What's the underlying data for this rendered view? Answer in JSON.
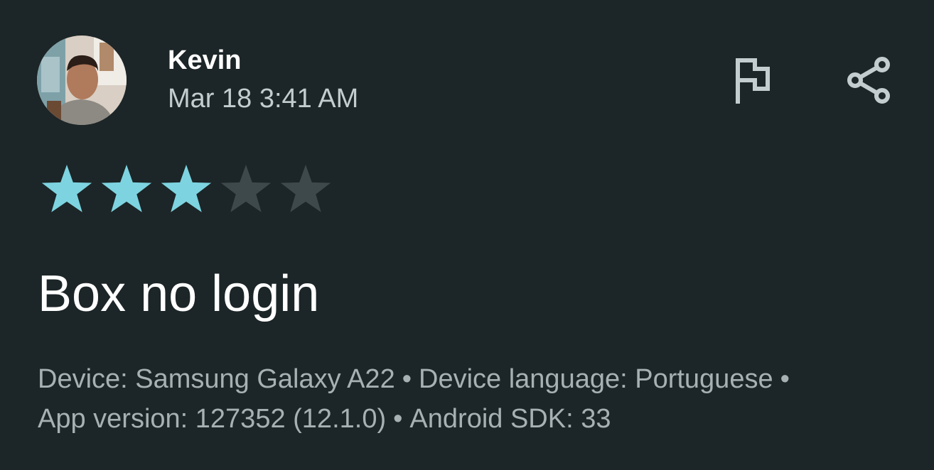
{
  "review": {
    "author": "Kevin",
    "date": "Mar 18 3:41 AM",
    "rating": 3,
    "max_rating": 5,
    "title": "Box no login",
    "device_label": "Device: Samsung Galaxy A22",
    "language_label": "Device language: Portuguese",
    "app_version_label": "App version: 127352 (12.1.0)",
    "sdk_label": "Android SDK: 33",
    "separator": "•"
  },
  "actions": {
    "flag_icon": "flag-icon",
    "share_icon": "share-icon"
  },
  "colors": {
    "background": "#1c2527",
    "star_filled": "#7dd4e0",
    "star_empty": "#3e494b",
    "icon": "#c3cdcf",
    "meta_text": "#a7b1b3"
  }
}
